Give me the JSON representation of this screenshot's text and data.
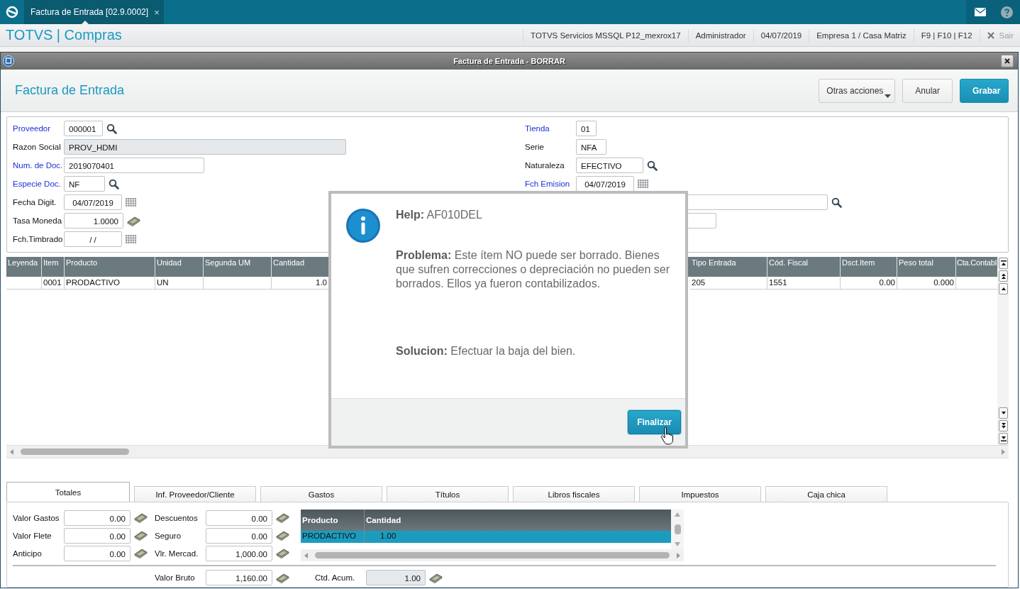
{
  "app_bar": {
    "tab": {
      "label": "Factura de Entrada [02.9.0002]",
      "selected": true,
      "close": "×"
    }
  },
  "header": {
    "brand": "TOTVS | Compras",
    "info": [
      "TOTVS Servicios MSSQL P12_mexrox17",
      "Administrador",
      "04/07/2019",
      "Empresa 1 / Casa Matriz",
      "F9 | F10 | F12"
    ],
    "exit": "Sair"
  },
  "window": {
    "title": "Factura de Entrada - BORRAR",
    "heading": "Factura de Entrada",
    "actions": [
      {
        "label": "Otras acciones",
        "kind": "menu"
      },
      {
        "label": "Anular",
        "kind": "default"
      },
      {
        "label": "Grabar",
        "kind": "primary"
      }
    ]
  },
  "form": {
    "left": [
      {
        "label": "Proveedor",
        "required": true,
        "value": "000001",
        "kind": "lookup"
      },
      {
        "label": "Razon Social",
        "required": false,
        "value": "PROV_HDMI",
        "kind": "readonly"
      },
      {
        "label": "Num. de Doc.",
        "required": true,
        "value": "2019070401",
        "kind": "text"
      },
      {
        "label": "Especie Doc.",
        "required": true,
        "value": "NF",
        "kind": "lookup"
      },
      {
        "label": "Fecha Digit.",
        "required": false,
        "value": "04/07/2019",
        "kind": "date"
      },
      {
        "label": "Tasa Moneda",
        "required": false,
        "value": "1.0000",
        "kind": "money"
      },
      {
        "label": "Fch.Timbrado",
        "required": false,
        "value": "/ /",
        "kind": "date"
      }
    ],
    "right": [
      {
        "label": "Tienda",
        "required": true,
        "value": "01",
        "kind": "text"
      },
      {
        "label": "Serie",
        "required": false,
        "value": "NFA",
        "kind": "text"
      },
      {
        "label": "Naturaleza",
        "required": false,
        "value": "EFECTIVO",
        "kind": "lookup"
      },
      {
        "label": "Fch Emision",
        "required": true,
        "value": "04/07/2019",
        "kind": "date"
      },
      {
        "kind": "lookup"
      },
      {
        "kind": "text"
      }
    ]
  },
  "grid": {
    "columns_left": [
      {
        "label": "Leyenda",
        "kind": "text"
      },
      {
        "label": "Item",
        "kind": "text"
      },
      {
        "label": "Producto",
        "kind": "text"
      },
      {
        "label": "Unidad",
        "kind": "text"
      },
      {
        "label": "Segunda UM",
        "kind": "text"
      },
      {
        "label": "Cantidad",
        "kind": "number"
      }
    ],
    "columns_right": [
      {
        "label": "Tipo Entrada",
        "kind": "text"
      },
      {
        "label": "Cód. Fiscal",
        "kind": "text"
      },
      {
        "label": "Dsct.Item",
        "kind": "number"
      },
      {
        "label": "Peso total",
        "kind": "number"
      },
      {
        "label": "Cta.Contabl",
        "kind": "text"
      }
    ],
    "rows": [
      {
        "item": "0001",
        "producto": "PRODACTIVO",
        "unidad": "UN",
        "cantidad": "1.0",
        "tipo_entrada": "205",
        "cod_fiscal": "1551",
        "dsct_item": "0.00",
        "peso_total": "0.000"
      }
    ]
  },
  "tabs": [
    {
      "label": "Totales",
      "selected": true
    },
    {
      "label": "Inf. Proveedor/Cliente",
      "selected": false
    },
    {
      "label": "Gastos",
      "selected": false
    },
    {
      "label": "Títulos",
      "selected": false
    },
    {
      "label": "Libros fiscales",
      "selected": false
    },
    {
      "label": "Impuestos",
      "selected": false
    },
    {
      "label": "Caja chica",
      "selected": false
    }
  ],
  "totals": {
    "column_1": [
      {
        "label": "Valor Gastos",
        "value": "0.00"
      },
      {
        "label": "Valor Flete",
        "value": "0.00"
      },
      {
        "label": "Anticipo",
        "value": "0.00"
      }
    ],
    "column_2": [
      {
        "label": "Descuentos",
        "value": "0.00"
      },
      {
        "label": "Seguro",
        "value": "0.00"
      },
      {
        "label": "Vlr. Mercad.",
        "value": "1,000.00"
      }
    ],
    "products": {
      "columns": [
        "Producto",
        "Cantidad"
      ],
      "rows": [
        {
          "cells": [
            "PRODACTIVO",
            "1.00"
          ],
          "selected": true
        }
      ]
    },
    "bottom": [
      {
        "label": "Valor Bruto",
        "value": "1,160.00",
        "readonly": false
      },
      {
        "label": "Ctd. Acum.",
        "value": "1.00",
        "readonly": true
      }
    ]
  },
  "dialog": {
    "title": "**Help:** AF010DEL",
    "problem": "**Problema:** Este ítem NO puede ser borrado. Bienes que sufren correcciones o depreciación no pueden ser borrados. Ellos ya fueron contabilizados.",
    "solution": "**Solucion:** Efectuar la baja del bien.",
    "button": "Finalizar"
  }
}
